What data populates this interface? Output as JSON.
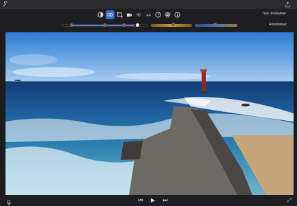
{
  "top_bar": {
    "left_icon": "wrench-icon",
    "right_icon": "share-icon"
  },
  "adjustment_toolbar": {
    "tools": [
      {
        "name": "color-balance-icon",
        "active": false
      },
      {
        "name": "color-correction-icon",
        "active": true
      },
      {
        "name": "crop-icon",
        "active": false
      },
      {
        "name": "stabilization-icon",
        "active": false
      },
      {
        "name": "volume-icon",
        "active": false
      },
      {
        "name": "noise-reduction-icon",
        "active": false
      },
      {
        "name": "speed-icon",
        "active": false
      },
      {
        "name": "filter-icon",
        "active": false
      },
      {
        "name": "info-icon",
        "active": false
      }
    ],
    "reset_all_label": "Tout réinitialiser",
    "reset_label": "Réinitialiser"
  },
  "color_sliders": {
    "levels": {
      "low": 0.1,
      "mid": 0.5,
      "high": 0.85,
      "max": 0.93
    },
    "saturation": 0.55,
    "temperature": 0.45
  },
  "viewer": {
    "scene": "coastal-breakwater-photo"
  },
  "playback_bar": {
    "left_icon": "microphone-icon",
    "controls": [
      "skip-back-icon",
      "play-icon",
      "skip-forward-icon"
    ],
    "right_icon": "fullscreen-icon"
  }
}
